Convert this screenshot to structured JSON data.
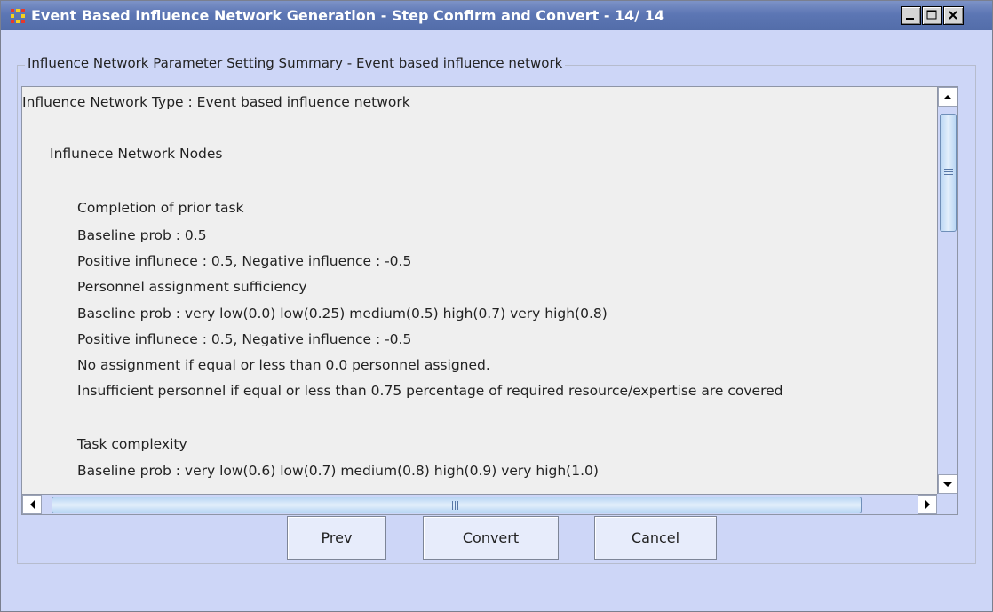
{
  "window": {
    "title": "Event Based Influence Network Generation - Step Confirm and Convert - 14/ 14",
    "controls": [
      "minimize-icon",
      "maximize-icon",
      "close-icon"
    ]
  },
  "summary": {
    "group_title": "Influence Network Parameter Setting Summary - Event based influence network",
    "lines": [
      "Influence Network Type : Event based influence network",
      "Influnece Network Nodes",
      "Completion of prior task",
      "Baseline prob : 0.5",
      "Positive influnece : 0.5, Negative influence : -0.5",
      "Personnel assignment sufficiency",
      "Baseline prob : very low(0.0)  low(0.25)  medium(0.5)  high(0.7)  very high(0.8)",
      "Positive influnece : 0.5, Negative influence : -0.5",
      "No assignment if equal or less than 0.0 personnel assigned.",
      "Insufficient personnel if equal or less than 0.75 percentage of required resource/expertise are covered",
      "Task complexity",
      "Baseline prob : very low(0.6)  low(0.7)  medium(0.8)  high(0.9)  very high(1.0)"
    ]
  },
  "buttons": {
    "prev": "Prev",
    "convert": "Convert",
    "cancel": "Cancel"
  },
  "colors": {
    "titlebar": "#5c76b4",
    "window_bg": "#cdd6f7",
    "text_area_bg": "#efefef",
    "scroll_thumb": "#b9d6f4"
  }
}
